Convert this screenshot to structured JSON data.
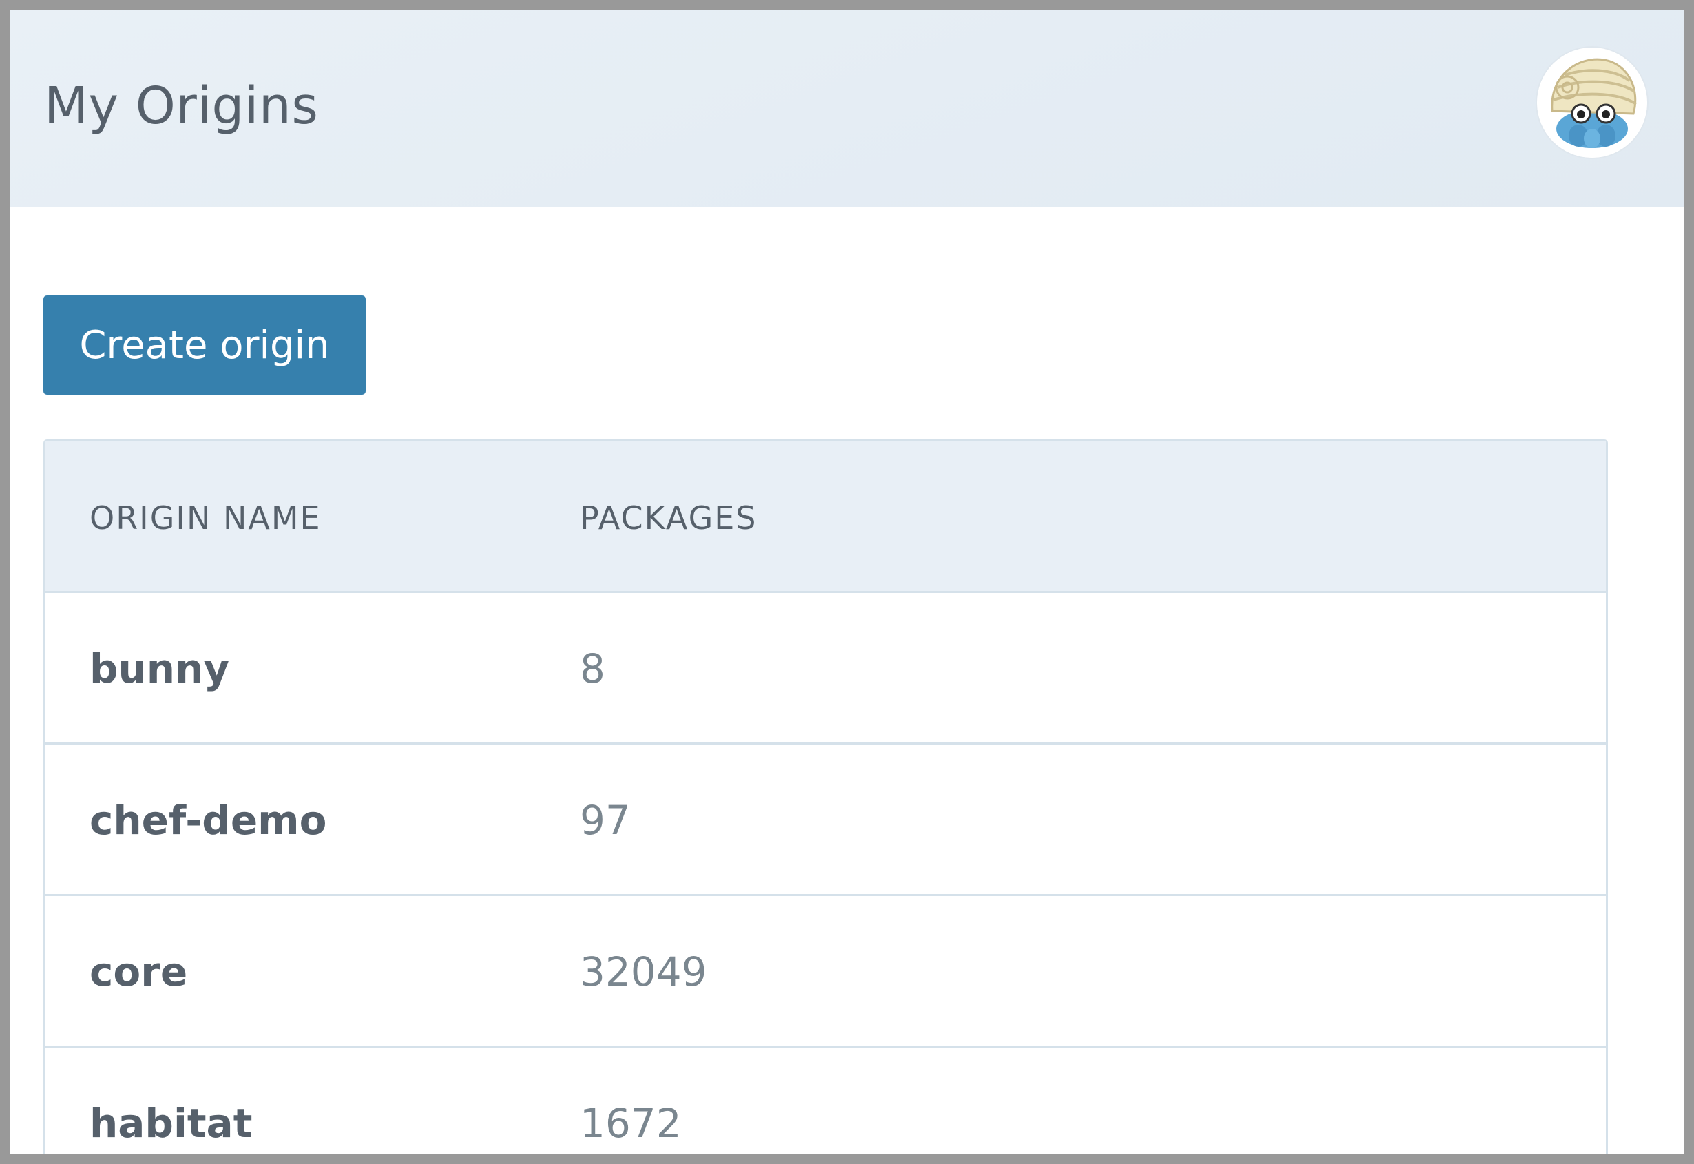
{
  "header": {
    "title": "My Origins",
    "avatar_icon": "omanyte-avatar-icon"
  },
  "toolbar": {
    "create_label": "Create origin",
    "accent_color": "#3680ad"
  },
  "table": {
    "columns": [
      "ORIGIN NAME",
      "PACKAGES"
    ],
    "rows": [
      {
        "name": "bunny",
        "packages": "8"
      },
      {
        "name": "chef-demo",
        "packages": "97"
      },
      {
        "name": "core",
        "packages": "32049"
      },
      {
        "name": "habitat",
        "packages": "1672"
      }
    ]
  }
}
